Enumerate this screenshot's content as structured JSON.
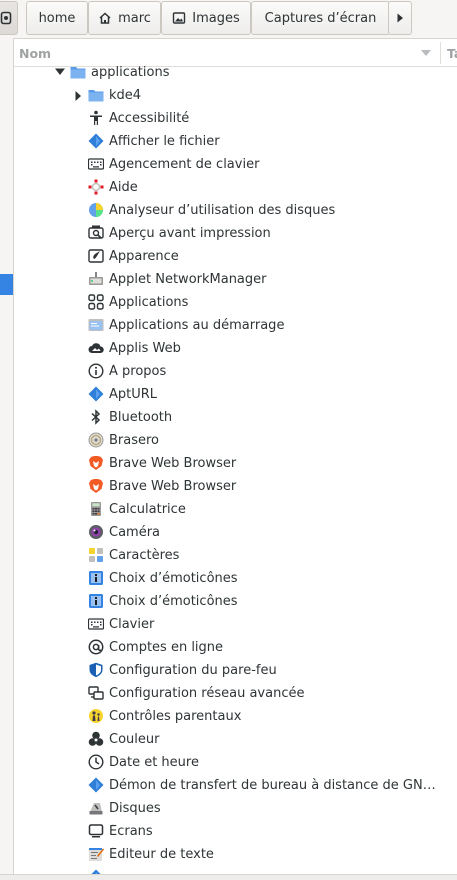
{
  "pathbar": {
    "segments": [
      {
        "label": "home",
        "icon": ""
      },
      {
        "label": "marc",
        "icon": "home-icon"
      },
      {
        "label": "Images",
        "icon": "image-icon"
      },
      {
        "label": "Captures d’écran",
        "icon": ""
      }
    ]
  },
  "columns": {
    "name": "Nom",
    "next": "Ta"
  },
  "tree": {
    "folder": "applications",
    "subfolder": "kde4",
    "items": [
      {
        "label": "Accessibilité",
        "icon": "accessibility-icon"
      },
      {
        "label": "Afficher le fichier",
        "icon": "diamond-icon"
      },
      {
        "label": "Agencement de clavier",
        "icon": "keyboard-icon"
      },
      {
        "label": "Aide",
        "icon": "help-icon"
      },
      {
        "label": "Analyseur d’utilisation des disques",
        "icon": "disk-usage-icon"
      },
      {
        "label": "Aperçu avant impression",
        "icon": "print-preview-icon"
      },
      {
        "label": "Apparence",
        "icon": "appearance-icon"
      },
      {
        "label": "Applet NetworkManager",
        "icon": "network-icon"
      },
      {
        "label": "Applications",
        "icon": "apps-grid-icon"
      },
      {
        "label": "Applications au démarrage",
        "icon": "startup-icon"
      },
      {
        "label": "Applis Web",
        "icon": "cloud-icon"
      },
      {
        "label": "À propos",
        "icon": "info-icon"
      },
      {
        "label": "AptURL",
        "icon": "diamond-icon"
      },
      {
        "label": "Bluetooth",
        "icon": "bluetooth-icon"
      },
      {
        "label": "Brasero",
        "icon": "disc-icon"
      },
      {
        "label": "Brave Web Browser",
        "icon": "brave-icon"
      },
      {
        "label": "Brave Web Browser",
        "icon": "brave-icon"
      },
      {
        "label": "Calculatrice",
        "icon": "calculator-icon"
      },
      {
        "label": "Caméra",
        "icon": "camera-icon"
      },
      {
        "label": "Caractères",
        "icon": "characters-icon"
      },
      {
        "label": "Choix d’émoticônes",
        "icon": "emoji-icon"
      },
      {
        "label": "Choix d’émoticônes",
        "icon": "emoji-icon"
      },
      {
        "label": "Clavier",
        "icon": "keyboard-icon"
      },
      {
        "label": "Comptes en ligne",
        "icon": "at-icon"
      },
      {
        "label": "Configuration du pare-feu",
        "icon": "firewall-icon"
      },
      {
        "label": "Configuration réseau avancée",
        "icon": "network-settings-icon"
      },
      {
        "label": "Contrôles parentaux",
        "icon": "parental-icon"
      },
      {
        "label": "Couleur",
        "icon": "color-icon"
      },
      {
        "label": "Date et heure",
        "icon": "clock-icon"
      },
      {
        "label": "Démon de transfert de bureau à distance de GNOME",
        "icon": "diamond-icon"
      },
      {
        "label": "Disques",
        "icon": "disks-icon"
      },
      {
        "label": "Écrans",
        "icon": "display-icon"
      },
      {
        "label": "Éditeur de texte",
        "icon": "text-editor-icon"
      },
      {
        "label": "",
        "icon": "diamond-icon"
      }
    ]
  },
  "colors": {
    "folder": "#5a9be8",
    "selection": "#3584e4",
    "brave": "#f25a24",
    "diamond": "#2f7ed8"
  }
}
